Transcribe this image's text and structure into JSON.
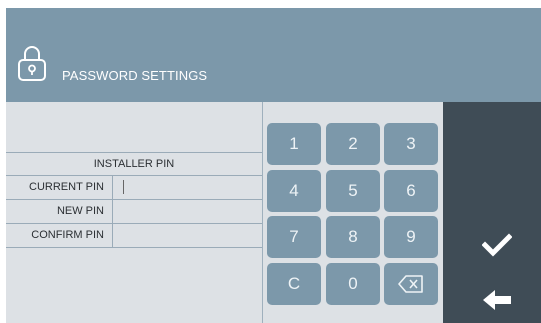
{
  "header": {
    "title": "PASSWORD SETTINGS",
    "icon": "lock-icon"
  },
  "form": {
    "section_title": "INSTALLER PIN",
    "fields": [
      {
        "label": "CURRENT PIN",
        "value": ""
      },
      {
        "label": "NEW PIN",
        "value": ""
      },
      {
        "label": "CONFIRM PIN",
        "value": ""
      }
    ]
  },
  "keypad": {
    "keys": [
      "1",
      "2",
      "3",
      "4",
      "5",
      "6",
      "7",
      "8",
      "9",
      "C",
      "0"
    ],
    "backspace_icon": "backspace-icon"
  },
  "actions": {
    "confirm_icon": "checkmark-icon",
    "back_icon": "back-arrow-icon"
  },
  "colors": {
    "header": "#7c98aa",
    "keys": "#7c98aa",
    "side_panel": "#3f4c56",
    "form_background": "#dde1e5"
  }
}
